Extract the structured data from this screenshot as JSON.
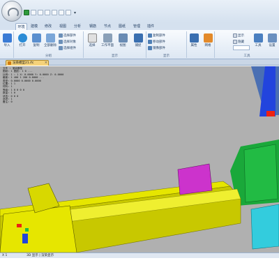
{
  "window": {
    "title": ""
  },
  "quick_access": {
    "more": "▾"
  },
  "tabs": [
    {
      "label": "环境",
      "active": true
    },
    {
      "label": "建模",
      "active": false
    },
    {
      "label": "修改",
      "active": false
    },
    {
      "label": "视图",
      "active": false
    },
    {
      "label": "分析",
      "active": false
    },
    {
      "label": "钢筋",
      "active": false
    },
    {
      "label": "节点",
      "active": false
    },
    {
      "label": "图纸",
      "active": false
    },
    {
      "label": "管理",
      "active": false
    },
    {
      "label": "插件",
      "active": false
    }
  ],
  "ribbon": {
    "groups": [
      {
        "label": ""
      },
      {
        "label": "分组"
      },
      {
        "label": "显示"
      },
      {
        "label": "显示"
      },
      {
        "label": ""
      },
      {
        "label": "工具"
      }
    ],
    "buttons": {
      "b1": "导入",
      "b2": "打开",
      "b3": "复制",
      "b4": "全部删除",
      "b5": "选择",
      "b6": "工作平面",
      "b7": "视图",
      "b8": "捕捉",
      "b9": "属性",
      "b10": "网格",
      "b11": "参考线",
      "b12": "工具",
      "b13": "设置"
    },
    "small": {
      "s1": "选择部件",
      "s2": "选择对象",
      "s3": "选择组件",
      "s4": "复制部件",
      "s5": "移动部件",
      "s6": "镜像部件",
      "s7": "显示",
      "s8": "隐藏",
      "s9": "锁定"
    },
    "inputs": {
      "i1": "",
      "i2": ""
    }
  },
  "document": {
    "tab_label": "渲染模型21.ifc",
    "close": "×"
  },
  "info_panel": {
    "lines": [
      "文件 : 渲染模型",
      "图纸: 1 图层: 1 0 ...",
      "比例: 1 : 1  X: 0.0000 Y: 0.0000 Z: 0.0000",
      "截面: 1 400 1 200 0.0000 ...",
      "类型: 0.0000 0.0000 0.0000",
      "位置: 1 1",
      "材料: 1",
      "等级: 1 0 0 0 0",
      "数量: 1 0",
      "状态: 0 0 0",
      "选项: 1",
      "备注: 0"
    ]
  },
  "statusbar": {
    "left": "X 1",
    "coords": "3D 显示 | 渲染显示"
  },
  "colors": {
    "viewport_bg": "#b0b0b0",
    "beam": "#e6e600",
    "beam_shade": "#c8c800",
    "magenta": "#cc33cc",
    "green_plate": "#22bb44",
    "cyan_plate": "#33ccdd",
    "blue_column": "#2244dd",
    "red_detail": "#ee2211"
  }
}
